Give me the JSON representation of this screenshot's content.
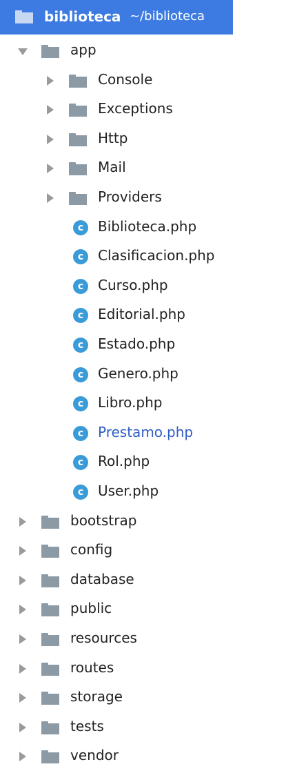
{
  "root": {
    "name": "biblioteca",
    "path": "~/biblioteca"
  },
  "app": {
    "label": "app"
  },
  "app_folders": [
    "Console",
    "Exceptions",
    "Http",
    "Mail",
    "Providers"
  ],
  "app_files": [
    "Biblioteca.php",
    "Clasificacion.php",
    "Curso.php",
    "Editorial.php",
    "Estado.php",
    "Genero.php",
    "Libro.php",
    "Prestamo.php",
    "Rol.php",
    "User.php"
  ],
  "active_file": "Prestamo.php",
  "root_folders": [
    "bootstrap",
    "config",
    "database",
    "public",
    "resources",
    "routes",
    "storage",
    "tests",
    "vendor"
  ],
  "icons": {
    "folder": "folder-icon",
    "class": "class-file-icon",
    "collapsed": "chevron-right-icon",
    "expanded": "chevron-down-icon"
  },
  "colors": {
    "selection": "#3d7be3",
    "folder": "#8c9aa6",
    "class_icon": "#3a9bd9",
    "active_text": "#2f5ec4"
  }
}
